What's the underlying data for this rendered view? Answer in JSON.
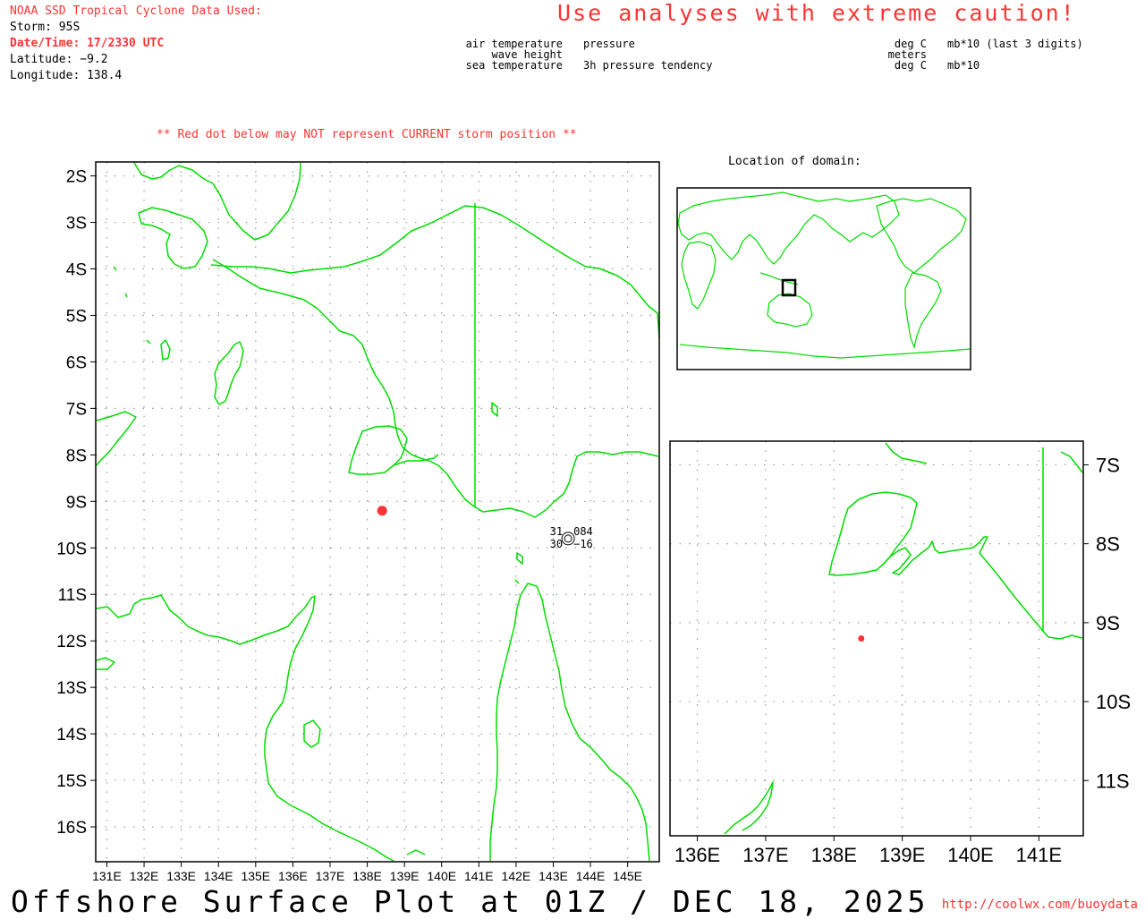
{
  "header": {
    "source": "NOAA SSD Tropical Cyclone Data Used:",
    "storm": "Storm: 95S",
    "datetime": "Date/Time: 17/2330 UTC",
    "latitude": "Latitude: −9.2",
    "longitude": "Longitude: 138.4",
    "caution": "Use analyses with extreme caution!",
    "red_dot_warning": "** Red dot below may NOT represent CURRENT storm position **"
  },
  "legend": {
    "left": {
      "air_temperature": "air temperature",
      "wave_height": "wave height",
      "sea_temperature": "sea temperature",
      "pressure": "pressure",
      "pressure_tendency": "3h pressure tendency"
    },
    "right": {
      "deg_c_top": "deg C",
      "meters": "meters",
      "deg_c_bottom": "deg C",
      "pressure_units": "mb*10 (last 3 digits)",
      "tendency_units": "mb*10"
    }
  },
  "main_map": {
    "lat_labels": [
      "2S",
      "3S",
      "4S",
      "5S",
      "6S",
      "7S",
      "8S",
      "9S",
      "10S",
      "11S",
      "12S",
      "13S",
      "14S",
      "15S",
      "16S"
    ],
    "lon_labels": [
      "131E",
      "132E",
      "133E",
      "134E",
      "135E",
      "136E",
      "137E",
      "138E",
      "139E",
      "140E",
      "141E",
      "142E",
      "143E",
      "144E",
      "145E"
    ],
    "storm_marker": {
      "lat": -9.2,
      "lon": 138.4,
      "color": "#ff3333"
    },
    "station": {
      "lat": -9.8,
      "lon": 143.4,
      "air_temperature": "31",
      "sea_temperature": "30",
      "pressure": "084",
      "pressure_tendency": "−16"
    }
  },
  "inset_location": {
    "title": "Location of domain:"
  },
  "zoom_map": {
    "lat_labels": [
      "7S",
      "8S",
      "9S",
      "10S",
      "11S"
    ],
    "lon_labels": [
      "136E",
      "137E",
      "138E",
      "139E",
      "140E",
      "141E"
    ]
  },
  "footer": {
    "title": "Offshore Surface Plot at 01Z / DEC 18, 2025",
    "url": "http://coolwx.com/buoydata"
  },
  "colors": {
    "coastline": "#00dd00",
    "accent": "#ff3333",
    "grid": "#999999"
  }
}
